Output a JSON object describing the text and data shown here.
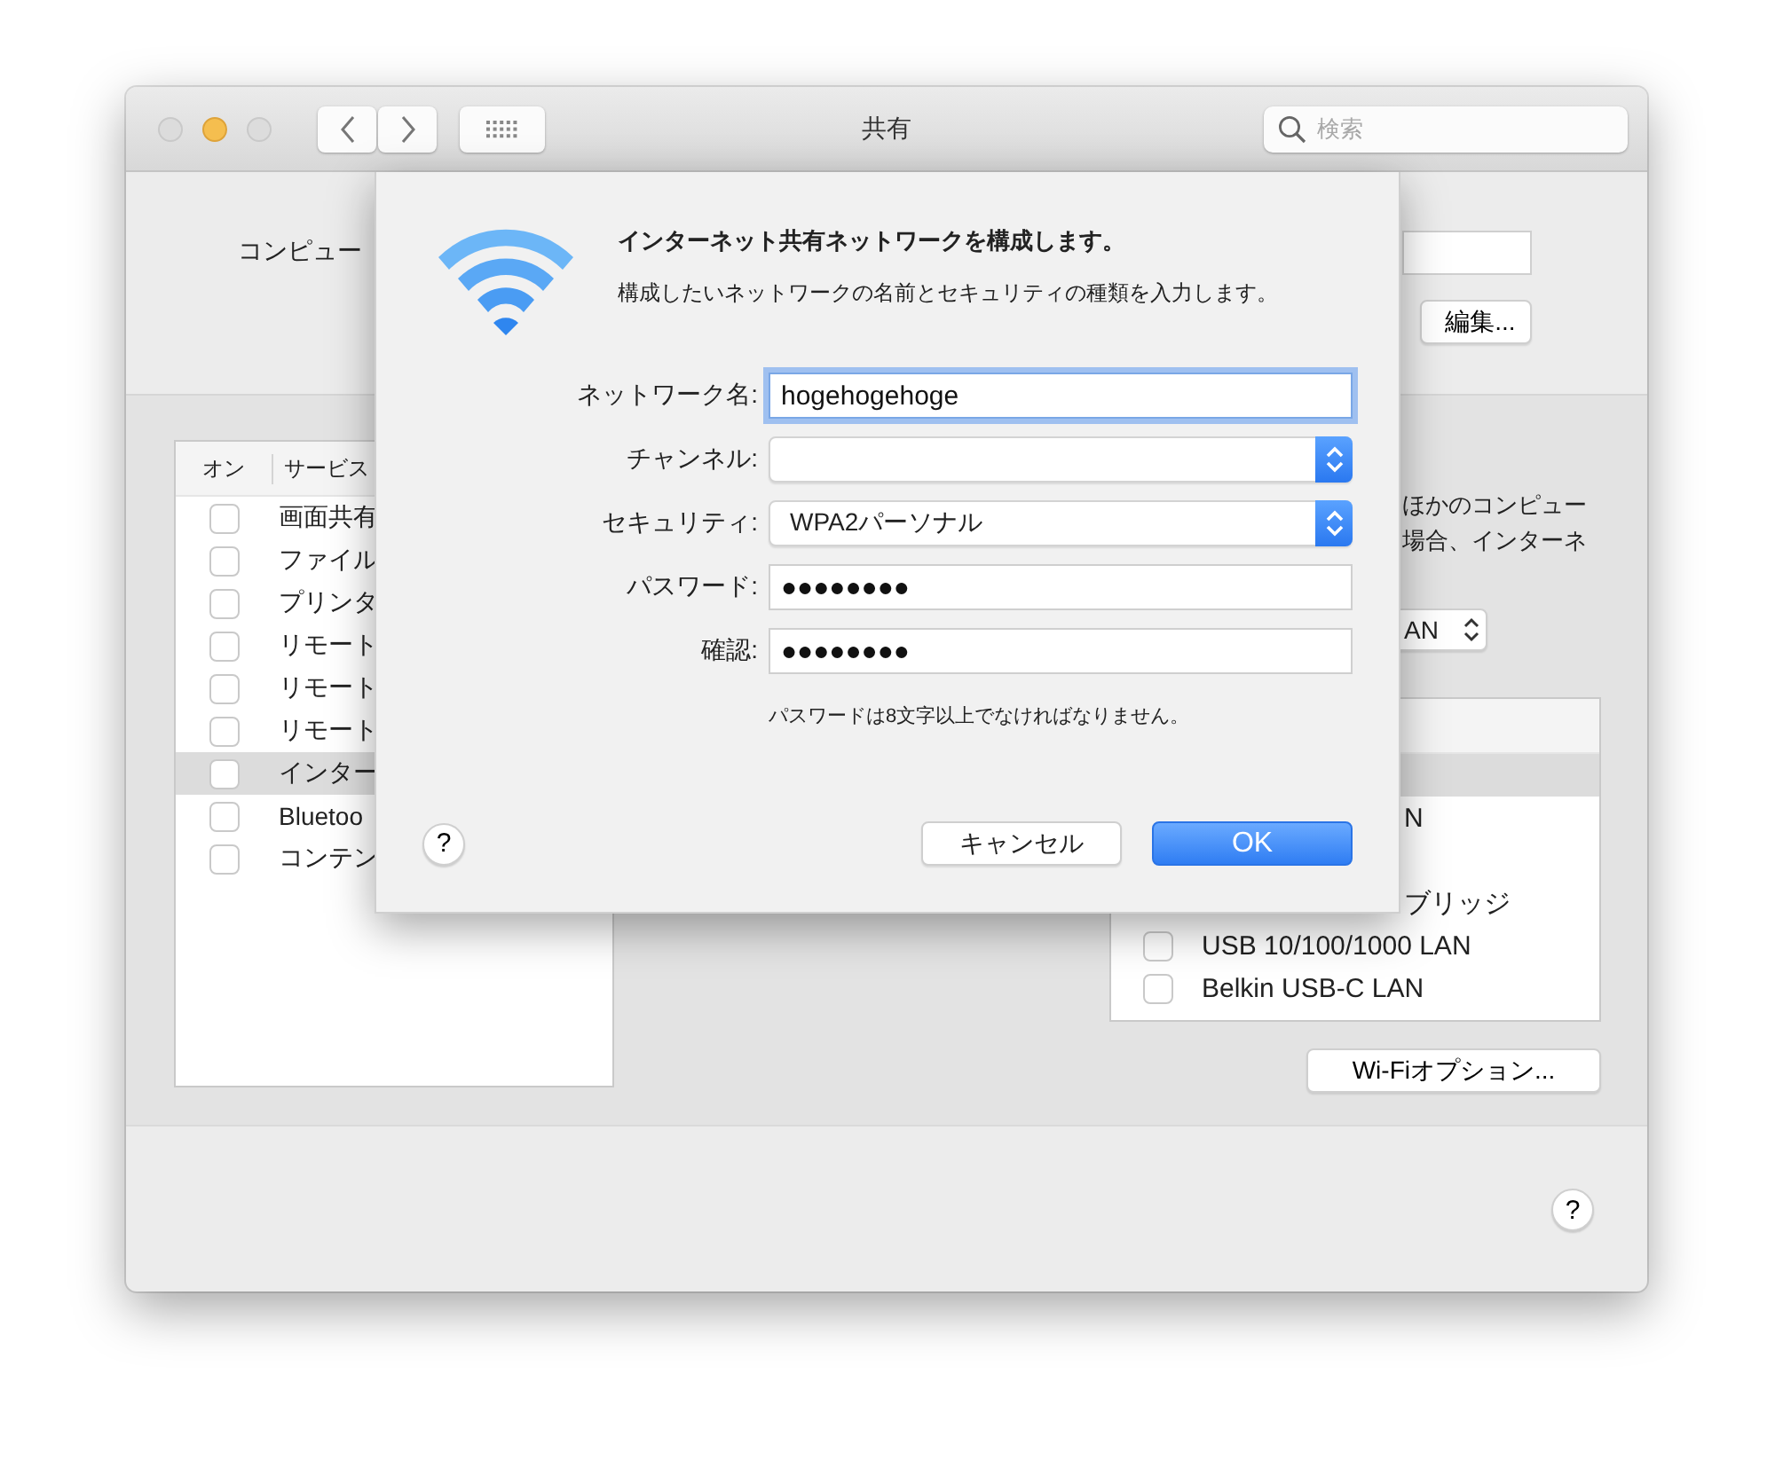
{
  "window": {
    "title": "共有",
    "search": {
      "placeholder": "検索"
    }
  },
  "computer_name": {
    "label": "コンピュー"
  },
  "edit_button": "編集...",
  "services": {
    "columns": [
      "オン",
      "サービス"
    ],
    "rows": [
      {
        "name": "画面共有",
        "checked": false,
        "selected": false
      },
      {
        "name": "ファイル",
        "checked": false,
        "selected": false
      },
      {
        "name": "プリンタ",
        "checked": false,
        "selected": false
      },
      {
        "name": "リモート",
        "checked": false,
        "selected": false
      },
      {
        "name": "リモート",
        "checked": false,
        "selected": false
      },
      {
        "name": "リモート",
        "checked": false,
        "selected": false
      },
      {
        "name": "インター",
        "checked": false,
        "selected": true
      },
      {
        "name": "Bluetoo",
        "checked": false,
        "selected": false
      },
      {
        "name": "コンテン",
        "checked": false,
        "selected": false
      }
    ]
  },
  "info_lines": [
    "ほかのコンピュー",
    "場合、インターネ"
  ],
  "share_popup": {
    "value": "AN"
  },
  "ports": {
    "rows": [
      {
        "kind": "blank",
        "selected": true
      },
      {
        "kind": "text",
        "name": "N",
        "selected": false
      },
      {
        "kind": "blank",
        "selected": false
      },
      {
        "kind": "text",
        "name": "ブリッジ",
        "selected": false
      },
      {
        "kind": "check",
        "name": "USB 10/100/1000 LAN",
        "checked": false,
        "selected": false
      },
      {
        "kind": "check",
        "name": "Belkin USB-C LAN",
        "checked": false,
        "selected": false
      }
    ]
  },
  "wifi_options_button": "Wi-Fiオプション...",
  "help_button": "?",
  "sheet": {
    "title": "インターネット共有ネットワークを構成します。",
    "subtitle": "構成したいネットワークの名前とセキュリティの種類を入力します。",
    "fields": [
      {
        "kind": "text",
        "label": "ネットワーク名:",
        "value": "hogehogehoge",
        "focused": true
      },
      {
        "kind": "popup",
        "label": "チャンネル:"
      },
      {
        "kind": "popup",
        "label": "セキュリティ:",
        "value": "WPA2パーソナル"
      },
      {
        "kind": "text",
        "label": "パスワード:",
        "value": "●●●●●●●●",
        "focused": false
      },
      {
        "kind": "text",
        "label": "確認:",
        "value": "●●●●●●●●",
        "focused": false
      }
    ],
    "note": "パスワードは8文字以上でなければなりません。",
    "help_button": "?",
    "buttons": [
      {
        "label": "キャンセル",
        "default": false
      },
      {
        "label": "OK",
        "default": true
      }
    ]
  }
}
